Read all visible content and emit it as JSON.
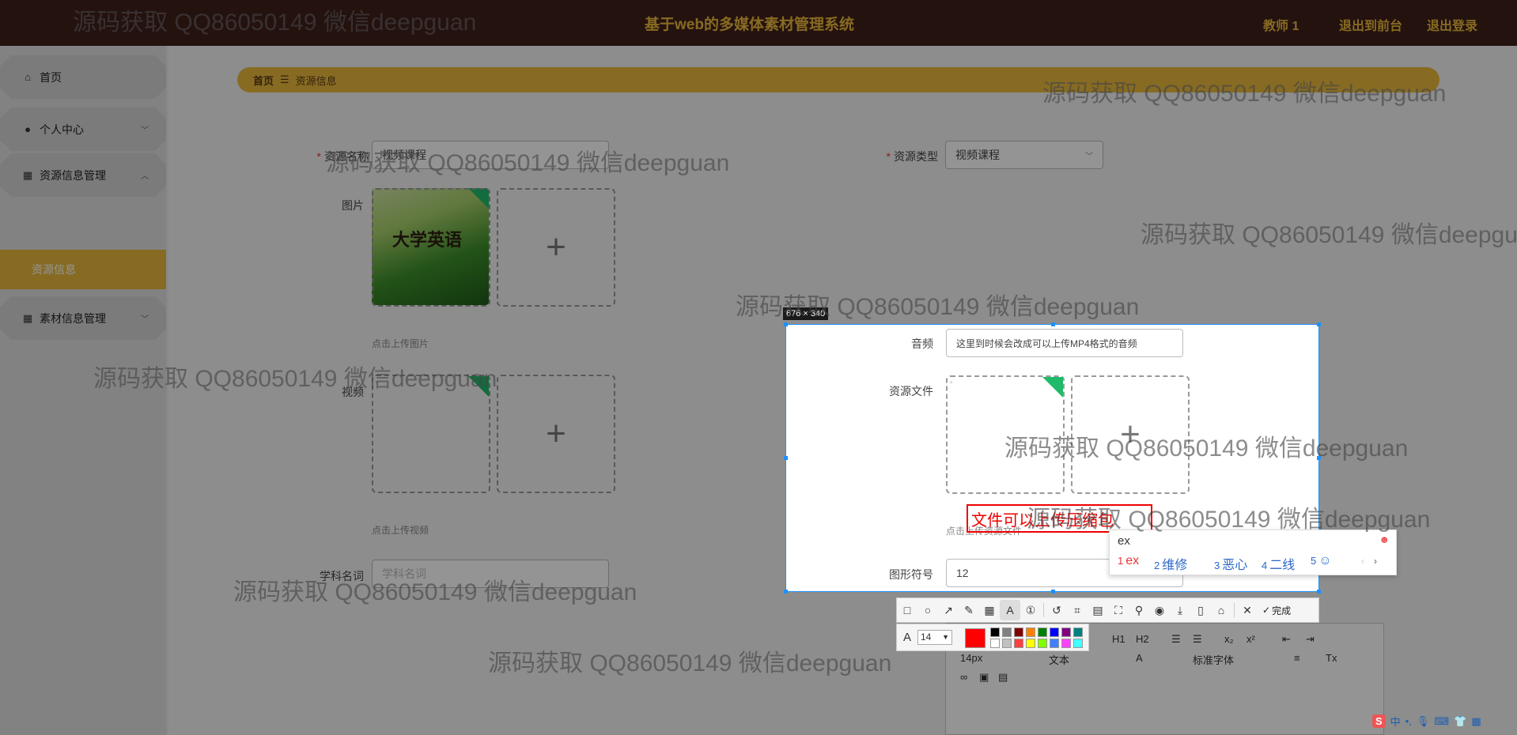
{
  "header": {
    "title": "基于web的多媒体素材管理系统",
    "user": "教师 1",
    "back_to_front": "退出到前台",
    "logout": "退出登录"
  },
  "sidebar": {
    "items": [
      {
        "label": "首页",
        "icon": "home-icon"
      },
      {
        "label": "个人中心",
        "icon": "user-icon"
      },
      {
        "label": "资源信息管理",
        "icon": "grid-icon"
      },
      {
        "label": "资源信息",
        "active": true
      },
      {
        "label": "素材信息管理",
        "icon": "grid-icon"
      }
    ]
  },
  "breadcrumb": {
    "home": "首页",
    "separator": "☰",
    "current": "资源信息"
  },
  "form": {
    "name_label": "资源名称",
    "name_value": "视频课程",
    "type_label": "资源类型",
    "type_value": "视频课程",
    "image_label": "图片",
    "image_hint": "点击上传图片",
    "cover_title": "大学英语",
    "video_label": "视频",
    "video_hint": "点击上传视频",
    "subject_label": "学科名词",
    "subject_placeholder": "学科名词",
    "audio_label": "音频",
    "audio_value": "这里到时候会改成可以上传MP4格式的音频",
    "file_label": "资源文件",
    "file_hint": "点击上传资源文件",
    "symbol_label": "图形符号",
    "symbol_value": "12"
  },
  "capture": {
    "size_label": "676 × 340",
    "annotation_text": "文件可以上传压缩包",
    "done_label": "完成",
    "font_size": "14",
    "colors": [
      "#ff0000",
      "#000000",
      "#808080",
      "#800000",
      "#ff8000",
      "#008000",
      "#0000ff",
      "#800080",
      "#008080",
      "#ffffff",
      "#c0c0c0",
      "#ff4040",
      "#ffff00",
      "#80ff00",
      "#4080ff",
      "#ff40ff",
      "#40ffff"
    ]
  },
  "ime": {
    "composition": "ex",
    "candidates": [
      {
        "n": "1",
        "t": "ex"
      },
      {
        "n": "2",
        "t": "维修"
      },
      {
        "n": "3",
        "t": "恶心"
      },
      {
        "n": "4",
        "t": "二线"
      },
      {
        "n": "5",
        "t": ""
      }
    ]
  },
  "editor": {
    "size": "14px",
    "block": "文本",
    "font": "标准字体",
    "h1": "H1",
    "h2": "H2"
  },
  "watermark": "源码获取 QQ86050149 微信deepguan",
  "tray": {
    "ime_mode": "中"
  }
}
